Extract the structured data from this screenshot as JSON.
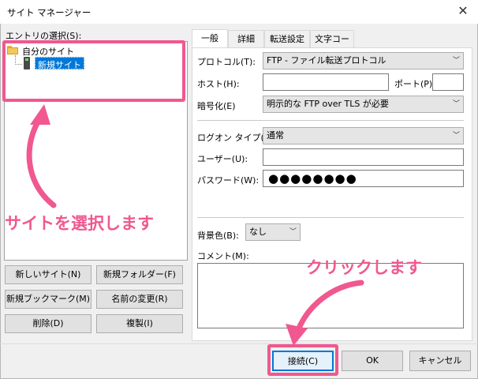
{
  "window": {
    "title": "サイト マネージャー",
    "close_glyph": "✕"
  },
  "tree": {
    "label": "エントリの選択(S):",
    "root_label": "自分のサイト",
    "site_label": "新規サイト"
  },
  "left_buttons": {
    "new_site": "新しいサイト(N)",
    "new_folder": "新規フォルダー(F)",
    "new_bookmark": "新規ブックマーク(M)",
    "rename": "名前の変更(R)",
    "delete": "削除(D)",
    "duplicate": "複製(I)"
  },
  "tabs": [
    "一般",
    "詳細",
    "転送設定",
    "文字コード"
  ],
  "general": {
    "protocol_label": "プロトコル(T):",
    "protocol_value": "FTP - ファイル転送プロトコル",
    "host_label": "ホスト(H):",
    "host_value": "",
    "port_label": "ポート(P):",
    "port_value": "",
    "encryption_label": "暗号化(E)",
    "encryption_value": "明示的な FTP over TLS が必要",
    "logon_type_label": "ログオン タイプ(L):",
    "logon_type_value": "通常",
    "user_label": "ユーザー(U):",
    "user_value": "",
    "password_label": "パスワード(W):",
    "password_value": "●●●●●●●●",
    "bg_color_label": "背景色(B):",
    "bg_color_value": "なし",
    "comment_label": "コメント(M):",
    "comment_value": ""
  },
  "bottom_buttons": {
    "connect": "接続(C)",
    "ok": "OK",
    "cancel": "キャンセル"
  },
  "annotations": {
    "select_site": "サイトを選択します",
    "click": "クリックします",
    "accent_color": "#f0588f"
  },
  "icons": {
    "root": "folder-icon",
    "site": "server-icon",
    "dropdown": "chevron-down-icon"
  }
}
